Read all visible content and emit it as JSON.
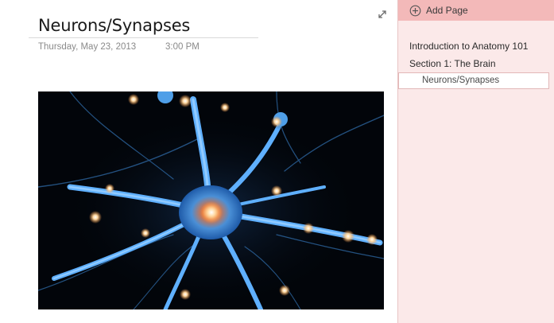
{
  "page": {
    "title": "Neurons/Synapses",
    "date": "Thursday, May 23, 2013",
    "time": "3:00 PM",
    "image_alt": "Neuron illustration"
  },
  "panel": {
    "add_page_label": "Add Page",
    "pages": [
      {
        "label": "Introduction to Anatomy 101"
      },
      {
        "label": "Section 1: The Brain"
      },
      {
        "label": "Neurons/Synapses",
        "selected": true
      }
    ]
  },
  "icons": {
    "expand": "expand-diagonal-arrows",
    "add": "plus-circle"
  },
  "colors": {
    "panel_bg": "#fbe9e9",
    "add_page_bar": "#f3b9b9",
    "meta_text": "#8a8a8a"
  }
}
